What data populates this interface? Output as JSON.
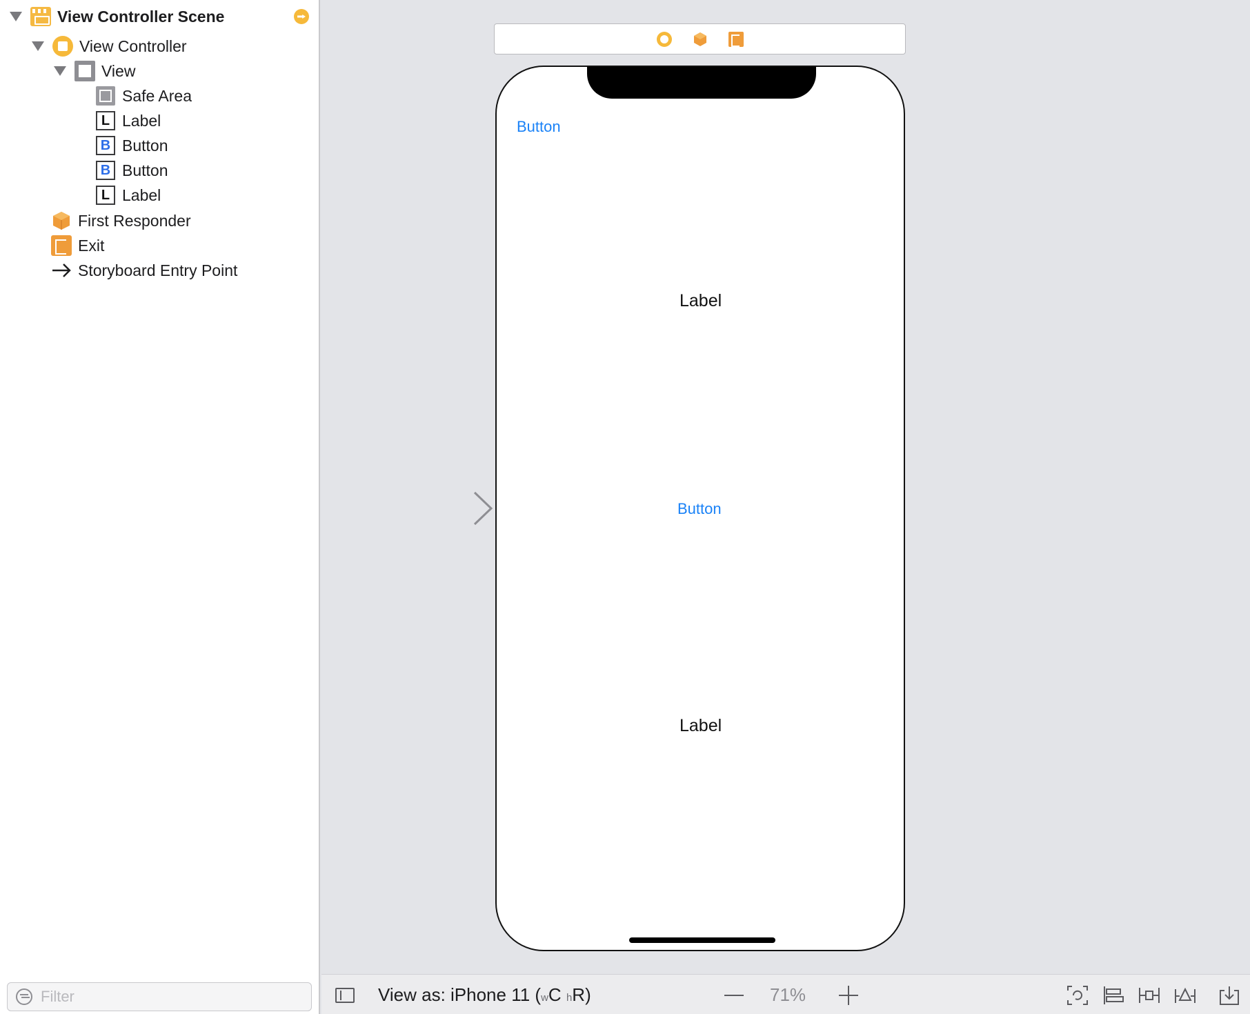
{
  "outline": {
    "scene_title": "View Controller Scene",
    "items": [
      {
        "label": "View Controller",
        "icon": "view-controller-icon"
      },
      {
        "label": "View",
        "icon": "view-icon"
      },
      {
        "label": "Safe Area",
        "icon": "safe-area-icon"
      },
      {
        "label": "Label",
        "icon": "label-icon",
        "letter": "L"
      },
      {
        "label": "Button",
        "icon": "button-icon",
        "letter": "B"
      },
      {
        "label": "Button",
        "icon": "button-icon",
        "letter": "B"
      },
      {
        "label": "Label",
        "icon": "label-icon",
        "letter": "L"
      },
      {
        "label": "First Responder",
        "icon": "first-responder-cube-icon"
      },
      {
        "label": "Exit",
        "icon": "exit-icon"
      },
      {
        "label": "Storyboard Entry Point",
        "icon": "arrow-right-icon"
      }
    ],
    "filter_placeholder": "Filter"
  },
  "canvas": {
    "top_button": "Button",
    "label_1": "Label",
    "center_button": "Button",
    "label_2": "Label"
  },
  "bottombar": {
    "view_as_prefix": "View as: iPhone 11 (",
    "w_letter": "w",
    "w_class": "C",
    "h_letter": "h",
    "h_class": "R",
    "suffix": ")",
    "zoom": "71%"
  },
  "colors": {
    "accent": "#1a82f7",
    "vc_yellow": "#f6b93a",
    "exit_orange": "#ef9c3a",
    "canvas_bg": "#e3e4e8"
  }
}
